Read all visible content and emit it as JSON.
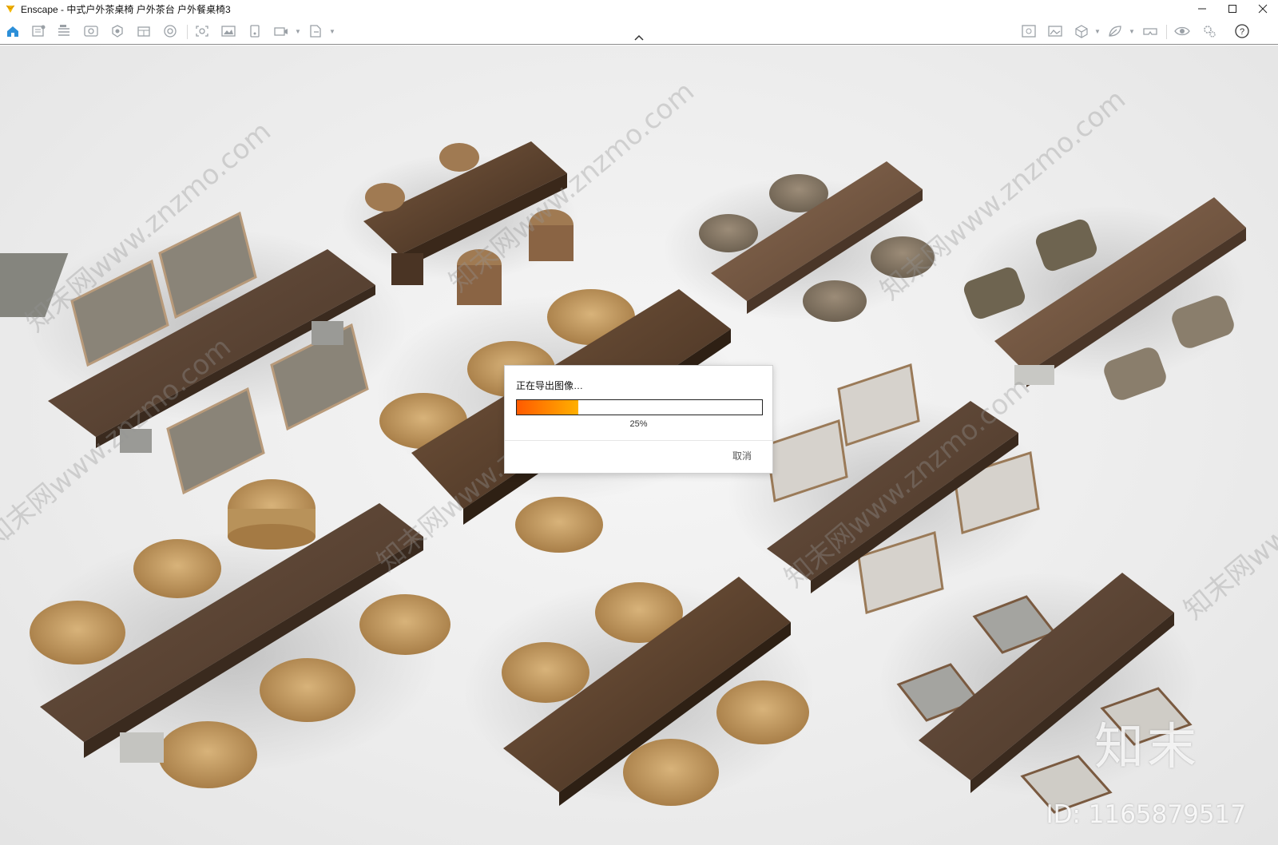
{
  "window": {
    "title": "Enscape - 中式户外茶桌椅 户外茶台 户外餐桌椅3",
    "controls": [
      "minimize",
      "maximize",
      "close"
    ]
  },
  "toolbar": {
    "left_icons": [
      "home-icon",
      "new-view-icon",
      "views-list-icon",
      "visual-settings-icon",
      "asset-library-icon",
      "material-editor-icon",
      "atmosphere-icon",
      "screenshot-icon",
      "batch-render-icon",
      "panorama-icon",
      "video-editor-icon",
      "export-icon"
    ],
    "right_icons": [
      "grid-view-icon",
      "image-icon",
      "cube-icon",
      "leaf-icon",
      "vr-headset-icon",
      "eye-icon",
      "settings-icon",
      "help-icon"
    ]
  },
  "viewport": {
    "watermark_text": "知末网www.znzmo.com",
    "brand_mark": "知末",
    "brand_id": "ID: 1165879517"
  },
  "dialog": {
    "title": "正在导出图像…",
    "progress_value": 25,
    "progress_label": "25%",
    "cancel_label": "取消",
    "bar_colors": [
      "#ff5a00",
      "#ffb000"
    ]
  }
}
